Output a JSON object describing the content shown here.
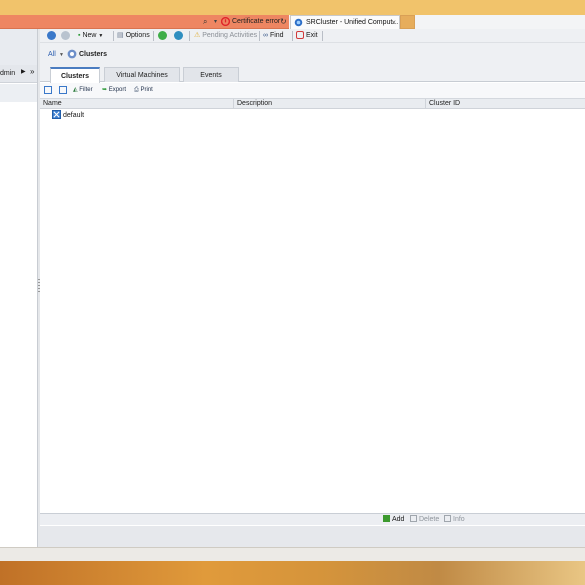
{
  "browser": {
    "address": {
      "search_icon": "search-icon",
      "certificate_error": "Certificate error",
      "error_color": "#e0252b"
    },
    "tab": {
      "title": "SRCluster - Unified Comput...",
      "close": "×"
    }
  },
  "sidebar": {
    "admin_label": "dmin",
    "expand": "▶",
    "collapse": "»"
  },
  "toolbar": {
    "new_label": "New",
    "options_label": "Options",
    "pending_label": "Pending Activities",
    "find_label": "Find",
    "exit_label": "Exit"
  },
  "breadcrumb": {
    "all": "All",
    "current": "Clusters"
  },
  "tabs": [
    {
      "label": "Clusters",
      "active": true
    },
    {
      "label": "Virtual Machines",
      "active": false
    },
    {
      "label": "Events",
      "active": false
    }
  ],
  "actions": {
    "filter": "Filter",
    "export": "Export",
    "print": "Print"
  },
  "grid": {
    "columns": [
      "Name",
      "Description",
      "Cluster ID"
    ],
    "rows": [
      {
        "name": "default",
        "description": "",
        "cluster_id": ""
      }
    ]
  },
  "bottom_bar": {
    "add": "Add",
    "delete": "Delete",
    "info": "Info"
  },
  "colors": {
    "accent": "#4a7cc0",
    "address_bar": "#ee8662",
    "add_green": "#3c9a2e"
  }
}
